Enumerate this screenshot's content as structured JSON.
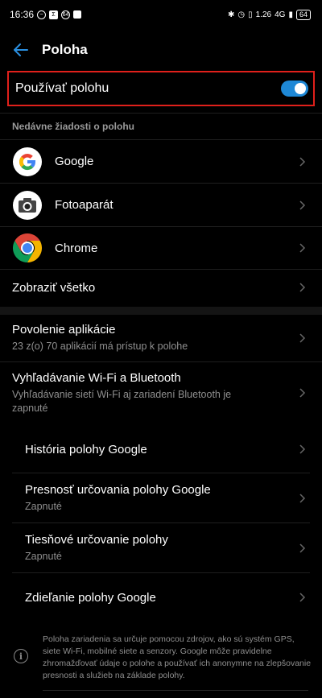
{
  "status_bar": {
    "time": "16:36",
    "left_icons": [
      "messenger-icon",
      "sigma-icon",
      "badge-64-icon",
      "image-icon"
    ],
    "badge_64": "64",
    "right_icons": [
      "bluetooth-icon",
      "alarm-icon",
      "vibrate-icon",
      "speed-icon",
      "signal-icon"
    ],
    "net_speed": "1.26",
    "network": "4G",
    "battery": "64"
  },
  "header": {
    "title": "Poloha"
  },
  "use_location": {
    "label": "Používať polohu",
    "enabled": true,
    "accent": "#1e88d6"
  },
  "recent_requests": {
    "header": "Nedávne žiadosti o polohu",
    "apps": [
      {
        "label": "Google",
        "icon": "google-icon"
      },
      {
        "label": "Fotoaparát",
        "icon": "camera-icon"
      },
      {
        "label": "Chrome",
        "icon": "chrome-icon"
      }
    ],
    "see_all": "Zobraziť všetko"
  },
  "settings": [
    {
      "title": "Povolenie aplikácie",
      "subtitle": "23 z(o) 70 aplikácií má prístup k polohe"
    },
    {
      "title": "Vyhľadávanie Wi-Fi a Bluetooth",
      "subtitle": "Vyhľadávanie sietí Wi-Fi aj zariadení Bluetooth je zapnuté"
    }
  ],
  "google_settings": [
    {
      "title": "História polohy Google",
      "subtitle": ""
    },
    {
      "title": "Presnosť určovania polohy Google",
      "subtitle": "Zapnuté"
    },
    {
      "title": "Tiesňové určovanie polohy",
      "subtitle": "Zapnuté"
    },
    {
      "title": "Zdieľanie polohy Google",
      "subtitle": ""
    }
  ],
  "footer": {
    "text": "Poloha zariadenia sa určuje pomocou zdrojov, ako sú systém GPS, siete Wi-Fi, mobilné siete a senzory. Google môže pravidelne zhromažďovať údaje o polohe a používať ich anonymne na zlepšovanie presnosti a služieb na základe polohy."
  }
}
